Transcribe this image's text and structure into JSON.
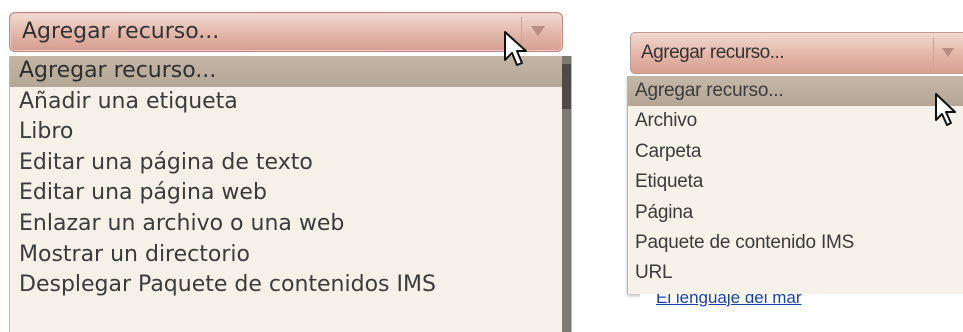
{
  "left_dropdown": {
    "selected": "Agregar recurso...",
    "options": [
      "Agregar recurso...",
      "Añadir una etiqueta",
      "Libro",
      "Editar una página de texto",
      "Editar una página web",
      "Enlazar un archivo o una web",
      "Mostrar un directorio",
      "Desplegar Paquete de contenidos IMS"
    ]
  },
  "right_dropdown": {
    "selected": "Agregar recurso...",
    "options": [
      "Agregar recurso...",
      "Archivo",
      "Carpeta",
      "Etiqueta",
      "Página",
      "Paquete de contenido IMS",
      "URL"
    ]
  },
  "background": {
    "partial_link_text": "El lenguaje del mar"
  },
  "colors": {
    "select_gradient_top": "#f3dcd4",
    "select_gradient_bottom": "#d69e90",
    "list_background": "#f5f1e8",
    "selected_option": "#bdae9e",
    "link": "#1a3fb0"
  },
  "icons": {
    "dropdown_arrow": "triangle-down-icon",
    "cursor": "mouse-pointer-icon"
  }
}
